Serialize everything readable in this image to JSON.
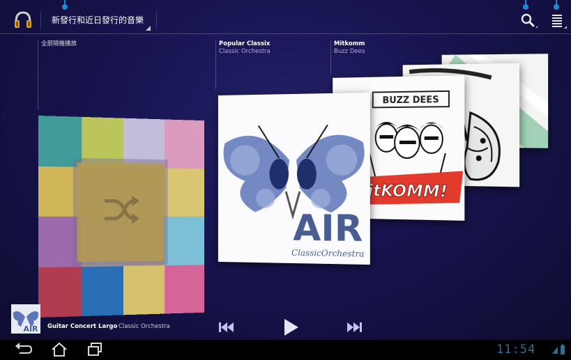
{
  "header": {
    "view_selector_label": "新發行和近日發行的音樂"
  },
  "columns": [
    {
      "title": "全部隨機播放",
      "subtitle": ""
    },
    {
      "title": "Popular Classix",
      "subtitle": "Classic Orchestra"
    },
    {
      "title": "Mitkomm",
      "subtitle": "Buzz Dees"
    }
  ],
  "albums": [
    {
      "art_text": "AIR",
      "art_subtext": "ClassicOrchestra"
    },
    {
      "art_text": "BUZZ DEES",
      "art_subtext": "itKOMM!"
    }
  ],
  "shuffle_colors": [
    "#44a6a0",
    "#c8d55c",
    "#cfcbe6",
    "#e9a5c7",
    "#e0c35a",
    "#c6b56a",
    "#cfb36a",
    "#e7d574",
    "#a871b6",
    "#b3a8a2",
    "#b8a598",
    "#86cde0",
    "#bf3f50",
    "#2a76c0",
    "#e6cf70",
    "#e56aa0"
  ],
  "now_playing": {
    "title": "Guitar Concert Largo",
    "artist": "Classic Orchestra"
  },
  "status": {
    "time": "11:54"
  },
  "icons": {
    "app": "headphones-icon",
    "search": "search-icon",
    "menu": "menu-icon",
    "shuffle": "shuffle-icon",
    "previous": "previous-icon",
    "play": "play-icon",
    "next": "next-icon",
    "back": "back-icon",
    "home": "home-icon",
    "recent": "recent-apps-icon"
  },
  "colors": {
    "background": "#171450",
    "accent": "#1e88d6",
    "clock": "#2e6f9a"
  }
}
